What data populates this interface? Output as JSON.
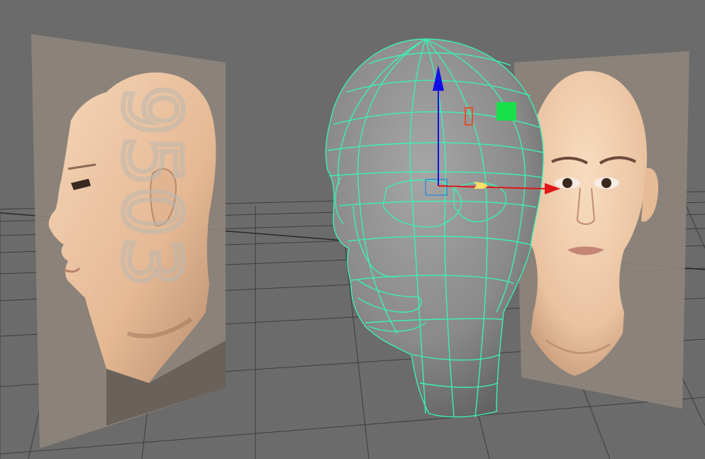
{
  "viewport": {
    "background": "#6b6b6b",
    "grid_color": "#3a3a3a",
    "wire_color": "#3cf0b4",
    "mesh_color": "#8a8a8a"
  },
  "side_image_plane": {
    "watermark_text": "9503",
    "icon": "side-profile-reference"
  },
  "front_image_plane": {
    "icon": "front-face-reference"
  },
  "head_mesh": {
    "icon": "head-polygon-mesh",
    "selected": true
  },
  "move_manipulator": {
    "icon": "move-tool-manipulator",
    "x_axis_color": "#e01818",
    "y_axis_color": "#1010e6",
    "z_handle_color": "#18e04a",
    "center_color": "#ffe066"
  }
}
